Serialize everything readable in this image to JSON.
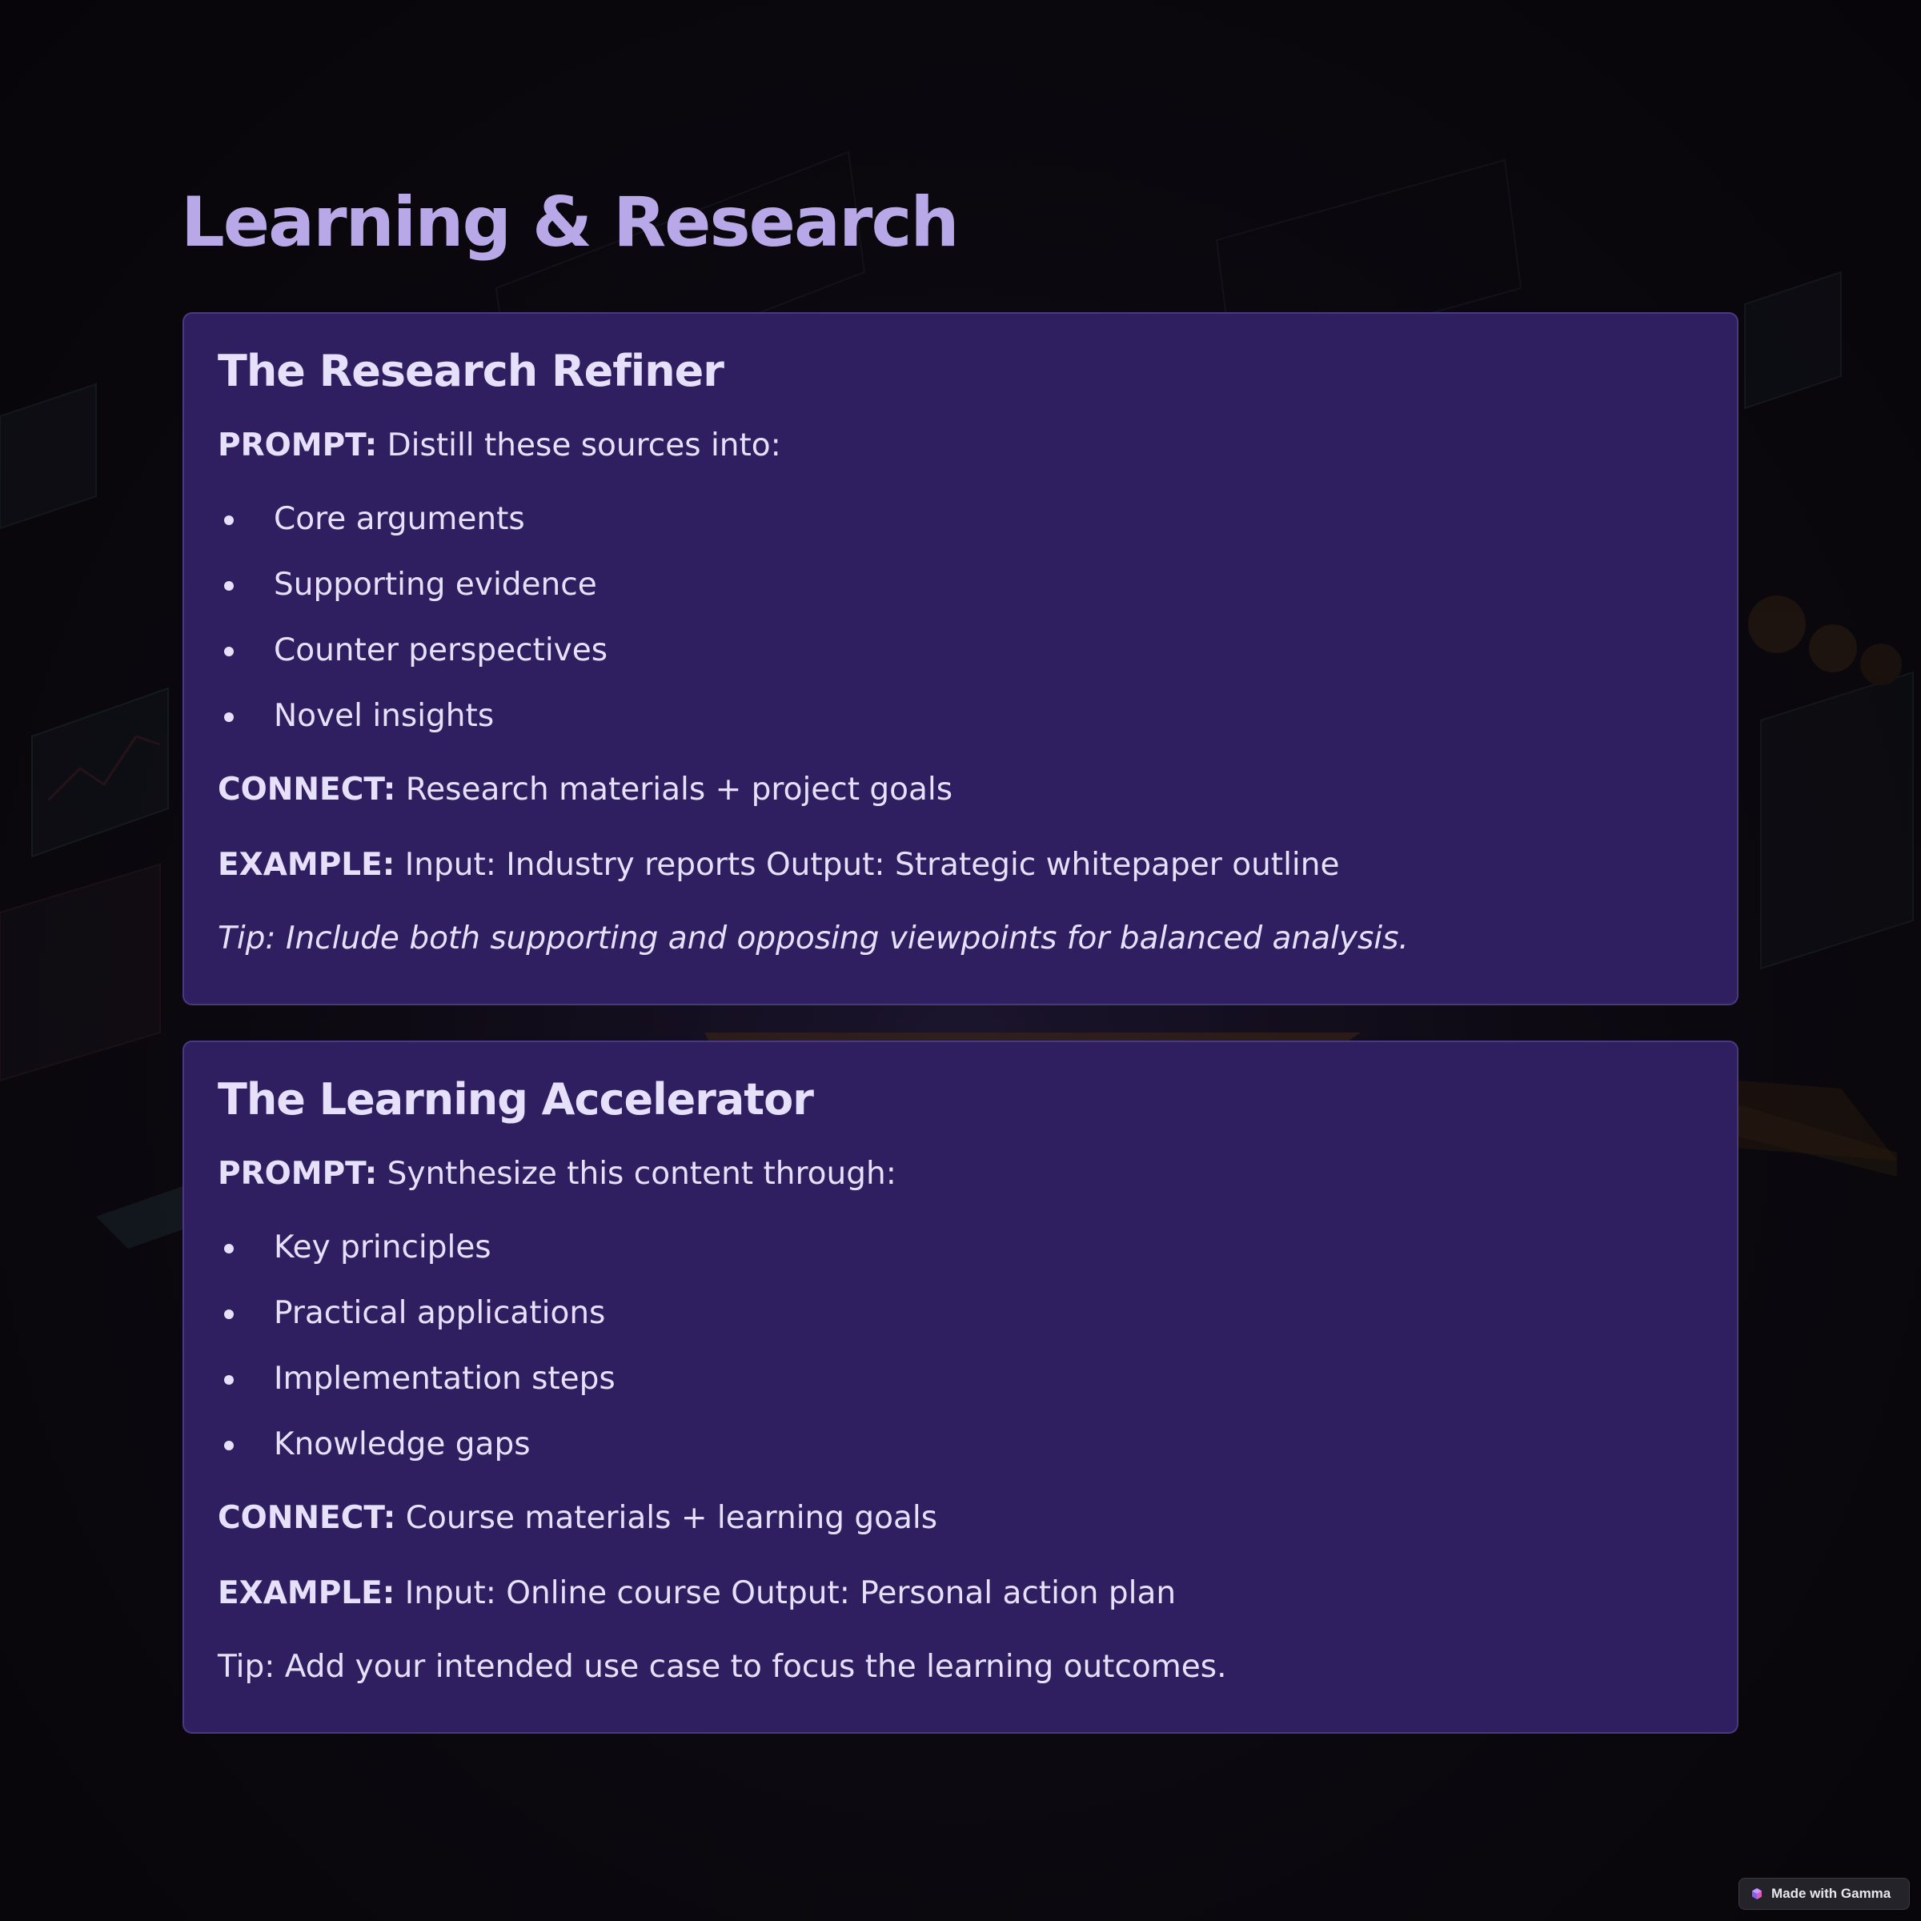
{
  "page": {
    "title": "Learning & Research"
  },
  "cards": [
    {
      "title": "The Research Refiner",
      "prompt_label": "PROMPT:",
      "prompt_text": " Distill these sources into:",
      "bullets": [
        "Core arguments",
        "Supporting evidence",
        "Counter perspectives",
        "Novel insights"
      ],
      "connect_label": "CONNECT:",
      "connect_text": " Research materials + project goals",
      "example_label": "EXAMPLE:",
      "example_text": " Input: Industry reports Output: Strategic whitepaper outline",
      "tip": "Tip: Include both supporting and opposing viewpoints for balanced analysis."
    },
    {
      "title": "The Learning Accelerator",
      "prompt_label": "PROMPT:",
      "prompt_text": " Synthesize this content through:",
      "bullets": [
        "Key principles",
        "Practical applications",
        "Implementation steps",
        "Knowledge gaps"
      ],
      "connect_label": "CONNECT:",
      "connect_text": " Course materials + learning goals",
      "example_label": "EXAMPLE:",
      "example_text": " Input: Online course Output: Personal action plan",
      "tip": "Tip: Add your intended use case to focus the learning outcomes."
    }
  ],
  "badge": {
    "label": "Made with Gamma",
    "icon": "gamma-logo-icon"
  },
  "colors": {
    "title": "#b8a8e8",
    "card_bg": "#2f1f60",
    "card_border": "#473a7e",
    "text": "#e7e0fb"
  }
}
